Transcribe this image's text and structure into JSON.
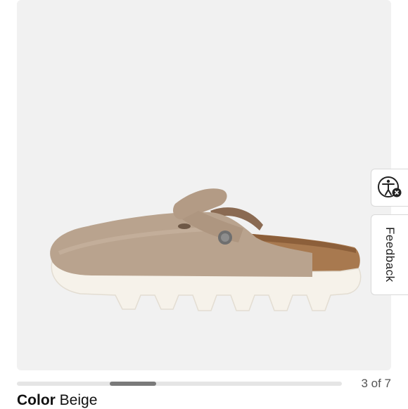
{
  "gallery": {
    "image_alt": "Beige suede clog with white lug sole",
    "counter_text": "3 of 7",
    "current_index": 3,
    "total": 7
  },
  "side_tabs": {
    "accessibility_icon": "accessibility-icon",
    "feedback_label": "Feedback"
  },
  "product": {
    "color_label": "Color",
    "color_value": "Beige"
  },
  "colors": {
    "image_bg": "#f1f1f1",
    "suede": "#b9a38e",
    "sole": "#f6f2ea",
    "cork": "#a8794f",
    "progress_thumb": "#7a7a7a"
  }
}
